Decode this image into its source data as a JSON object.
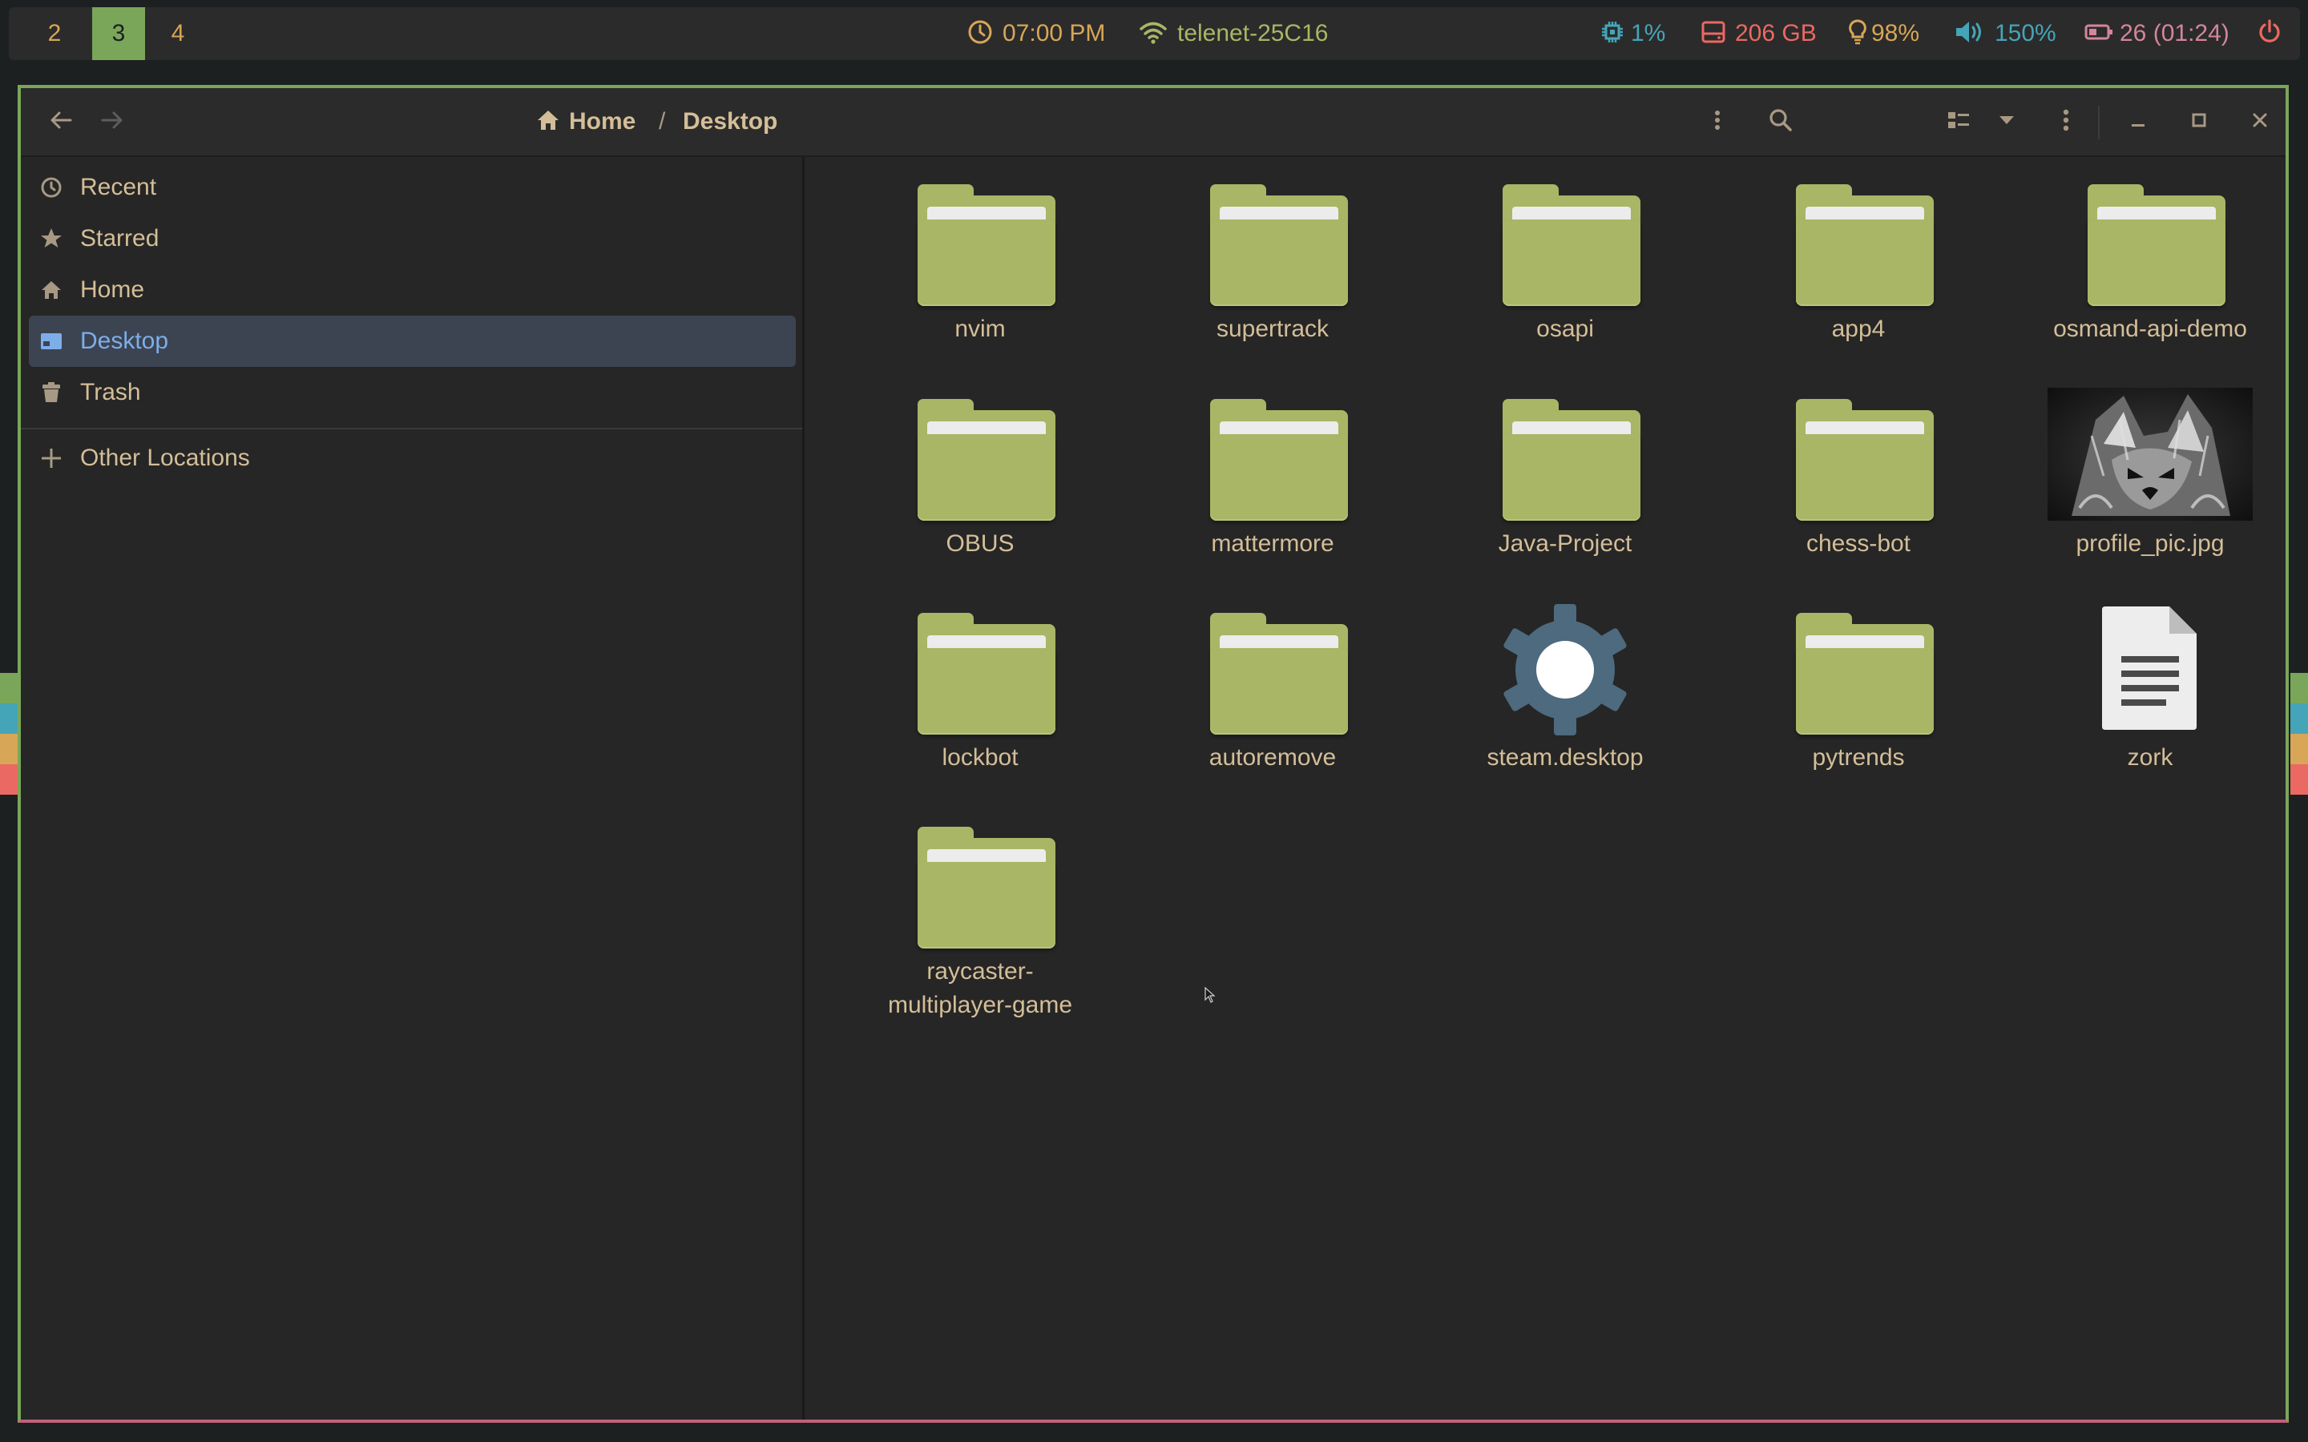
{
  "topbar": {
    "workspaces": [
      "2",
      "3",
      "4"
    ],
    "active_workspace": "3",
    "clock": "07:00 PM",
    "wifi": "telenet-25C16",
    "cpu": "1%",
    "disk": "206 GB",
    "brightness": "98%",
    "volume": "150%",
    "battery": "26 (01:24)",
    "icons": [
      "clock-icon",
      "wifi-icon",
      "cpu-icon",
      "disk-icon",
      "bulb-icon",
      "speaker-icon",
      "battery-icon",
      "power-icon"
    ],
    "colors": {
      "clock": "#d8a657",
      "wifi": "#a9b665",
      "cpu": "#45a5b8",
      "disk": "#ea6962",
      "brightness": "#d8a657",
      "volume": "#45a5b8",
      "battery": "#d3869b",
      "power": "#ea6962"
    }
  },
  "window": {
    "breadcrumb": {
      "home": "Home",
      "separator": "/",
      "current": "Desktop"
    },
    "toolbar_icons": [
      "back-icon",
      "forward-icon",
      "home-icon",
      "kebab-menu-icon",
      "search-icon",
      "list-view-icon",
      "chevron-down-icon",
      "more-menu-icon",
      "minimize-icon",
      "maximize-icon",
      "close-icon"
    ]
  },
  "sidebar": {
    "items": [
      {
        "label": "Recent",
        "icon": "recent-icon"
      },
      {
        "label": "Starred",
        "icon": "star-icon"
      },
      {
        "label": "Home",
        "icon": "home-icon"
      },
      {
        "label": "Desktop",
        "icon": "desktop-icon",
        "active": true
      },
      {
        "label": "Trash",
        "icon": "trash-icon"
      }
    ],
    "other_locations": "Other Locations"
  },
  "files": [
    {
      "name": "nvim",
      "type": "folder"
    },
    {
      "name": "supertrack",
      "type": "folder"
    },
    {
      "name": "osapi",
      "type": "folder"
    },
    {
      "name": "app4",
      "type": "folder"
    },
    {
      "name": "osmand-api-demo",
      "type": "folder"
    },
    {
      "name": "OBUS",
      "type": "folder"
    },
    {
      "name": "mattermore",
      "type": "folder"
    },
    {
      "name": "Java-Project",
      "type": "folder"
    },
    {
      "name": "chess-bot",
      "type": "folder"
    },
    {
      "name": "profile_pic.jpg",
      "type": "image"
    },
    {
      "name": "lockbot",
      "type": "folder"
    },
    {
      "name": "autoremove",
      "type": "folder"
    },
    {
      "name": "steam.desktop",
      "type": "desktop-file"
    },
    {
      "name": "pytrends",
      "type": "folder"
    },
    {
      "name": "zork",
      "type": "text-file"
    },
    {
      "name": "raycaster-",
      "name_line2": "multiplayer-game",
      "type": "folder"
    }
  ],
  "accent_colors": {
    "window_border": "#7aa65a",
    "folder": "#a9b665",
    "selection": "#3c4452",
    "text": "#d4be98"
  }
}
